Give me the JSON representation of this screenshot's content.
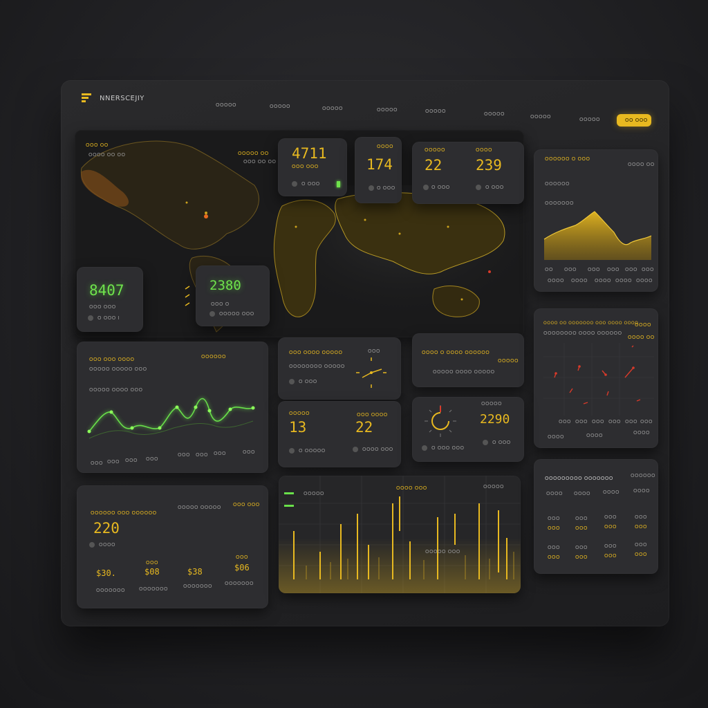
{
  "header": {
    "brand": "NNERSCEJIY",
    "nav": [
      "OOOOO",
      "OOOOO",
      "OOOOO",
      "OOOOO",
      "OOOOO",
      "OOOOO",
      "OOOOO",
      "OOOOO"
    ],
    "cta_label": "OO OOO"
  },
  "map_card": {
    "title": "OOO OO",
    "subtitle": "OOOO OO OO",
    "right_title": "OOOOO OO",
    "right_sub": "OOO OO OO"
  },
  "stat_a": {
    "value": "8407",
    "label": "OOO OOO",
    "sub": "O OOO I"
  },
  "stat_b": {
    "value": "2380",
    "label": "OOO O",
    "sub": "OOOOO OOO"
  },
  "kpi_1": {
    "label": "OOO OOO",
    "value": "4711",
    "sub": "O OOO"
  },
  "kpi_2": {
    "label": "OOOO",
    "value": "174",
    "sub": "O OOO"
  },
  "kpi_3": {
    "label": "OOOOO",
    "value": "22",
    "sub": "O OOO"
  },
  "kpi_4": {
    "label": "OOOO",
    "value": "239",
    "sub": "O OOO"
  },
  "area_card": {
    "title": "OOOOOO O OOO",
    "right": "OOOO OO",
    "row1": "OOOOOO",
    "row2": "OOOOOOO",
    "x_ticks": [
      "OO",
      "OOO",
      "OOO",
      "OOO",
      "OOO",
      "OOO"
    ],
    "x_ticks2": [
      "OOOO",
      "OOOO",
      "OOOO",
      "OOOO",
      "OOOO"
    ]
  },
  "line_card": {
    "title": "OOO OOO OOOO",
    "right": "OOOOOO",
    "sub1": "OOOOO OOOOO OOO",
    "sub2": "OOOOO OOOO OOO",
    "x_ticks": [
      "OOO",
      "OOO",
      "OOO",
      "OOO",
      "OOO",
      "OOO",
      "OOO",
      "OOO"
    ]
  },
  "clock_card": {
    "title": "OOO OOOO OOOOO",
    "sub": "OOOOOOOO OOOOO",
    "foot": "O OOO",
    "label": "OOO"
  },
  "info_card": {
    "title": "OOOO O OOOO OOOOOO",
    "sub": "OOOOO OOOO OOOOO",
    "right": "OOOOO"
  },
  "scatter_card": {
    "title": "OOOO OO OOOOOOO OOO OOOO OOOO",
    "sub": "OOOOOOOO OOOO OOOOOO",
    "right": "OOOO",
    "mini": "OOOO OO",
    "x_ticks": [
      "OOO",
      "OOO",
      "OOO",
      "OOO",
      "OOO",
      "OOO"
    ],
    "foot": [
      "OOOO",
      "OOOO",
      "OOOO"
    ]
  },
  "pair_card": {
    "label_a": "OOOOO",
    "value_a": "13",
    "sub_a": "O OOOOO",
    "label_b": "OOO OOOO",
    "value_b": "22",
    "sub_b": "OOOO OOO"
  },
  "gauge_card": {
    "label": "OOOOO",
    "value": "2290",
    "sub": "O OOO",
    "foot": "O OOO OOO"
  },
  "bottom_card": {
    "title": "OOOOOO OOO OOOOOO",
    "right": "OOOOO OOOOO",
    "value": "220",
    "sub": "OOOO",
    "right_sub": "OOO OOO",
    "values": [
      "$30.",
      "$08",
      "$38",
      "$06"
    ],
    "labels": [
      "OOO",
      "OOO",
      "OOO",
      "OOO"
    ],
    "foot": [
      "OOOOOOO",
      "OOOOOOO",
      "OOOOOOO",
      "OOOOOOO"
    ]
  },
  "candle_card": {
    "legend": [
      "OOOOO",
      "OOOO OOO",
      "OOOOO"
    ],
    "mid_label": "OOOOO OOO"
  },
  "table_card": {
    "title": "OOOOOOOOO OOOOOOO",
    "right": "OOOOOO",
    "headers": [
      "OOOO",
      "OOOO",
      "OOOO",
      "OOOO"
    ],
    "rows": [
      [
        "OOO",
        "OOO",
        "OOO",
        "OOO"
      ],
      [
        "OOO",
        "OOO",
        "OOO",
        "OOO"
      ],
      [
        "OOO",
        "OOO",
        "OOO",
        "OOO"
      ],
      [
        "OOO",
        "OOO",
        "OOO",
        "OOO"
      ]
    ]
  },
  "colors": {
    "accent": "#e8b920",
    "green": "#69e04a",
    "red": "#d83a2a",
    "panel": "#2d2d30"
  }
}
